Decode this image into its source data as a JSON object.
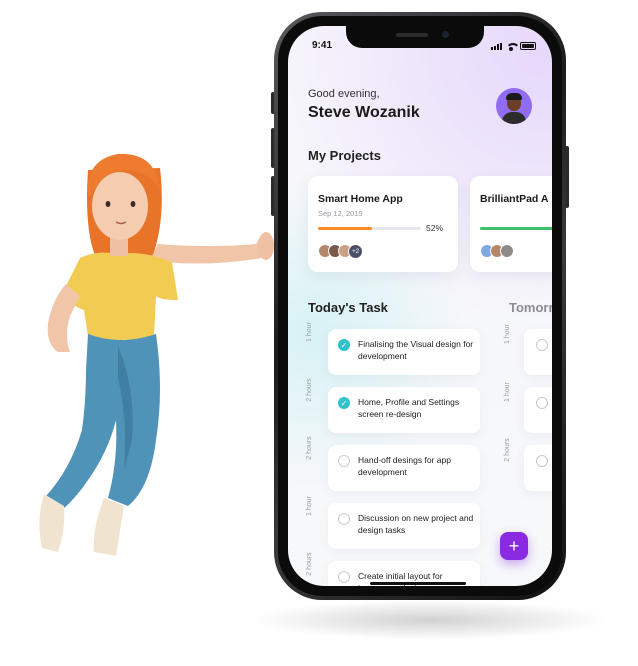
{
  "status_bar": {
    "time": "9:41"
  },
  "greeting": {
    "salutation": "Good evening,",
    "name": "Steve Wozanik"
  },
  "projects": {
    "title": "My Projects",
    "items": [
      {
        "name": "Smart Home App",
        "date": "Sep 12, 2019",
        "progress": 0.52,
        "progress_label": "52%",
        "bar_color": "#ff8a1f",
        "members_more": "+2"
      },
      {
        "name": "BrilliantPad A",
        "bar_color": "#3cc26a",
        "progress": 0.6
      }
    ]
  },
  "today": {
    "title": "Today's Task",
    "tasks": [
      {
        "duration": "1 hour",
        "text": "Finalising the Visual design for development",
        "done": true
      },
      {
        "duration": "2 hours",
        "text": "Home, Profile and Settings screen re-design",
        "done": true
      },
      {
        "duration": "2 hours",
        "text": "Hand-off desings for app development",
        "done": false
      },
      {
        "duration": "1 hour",
        "text": "Discussion on new project and design tasks",
        "done": false
      },
      {
        "duration": "2 hours",
        "text": "Create initial layout for homepage design",
        "done": false
      }
    ]
  },
  "tomorrow": {
    "title": "Tomorr",
    "durations": [
      "1 hour",
      "1 hour",
      "2 hours"
    ]
  },
  "colors": {
    "accent": "#8a2be2",
    "check": "#2fc3c9"
  },
  "icons": {
    "fab": "plus-icon"
  },
  "fab_label": "+"
}
